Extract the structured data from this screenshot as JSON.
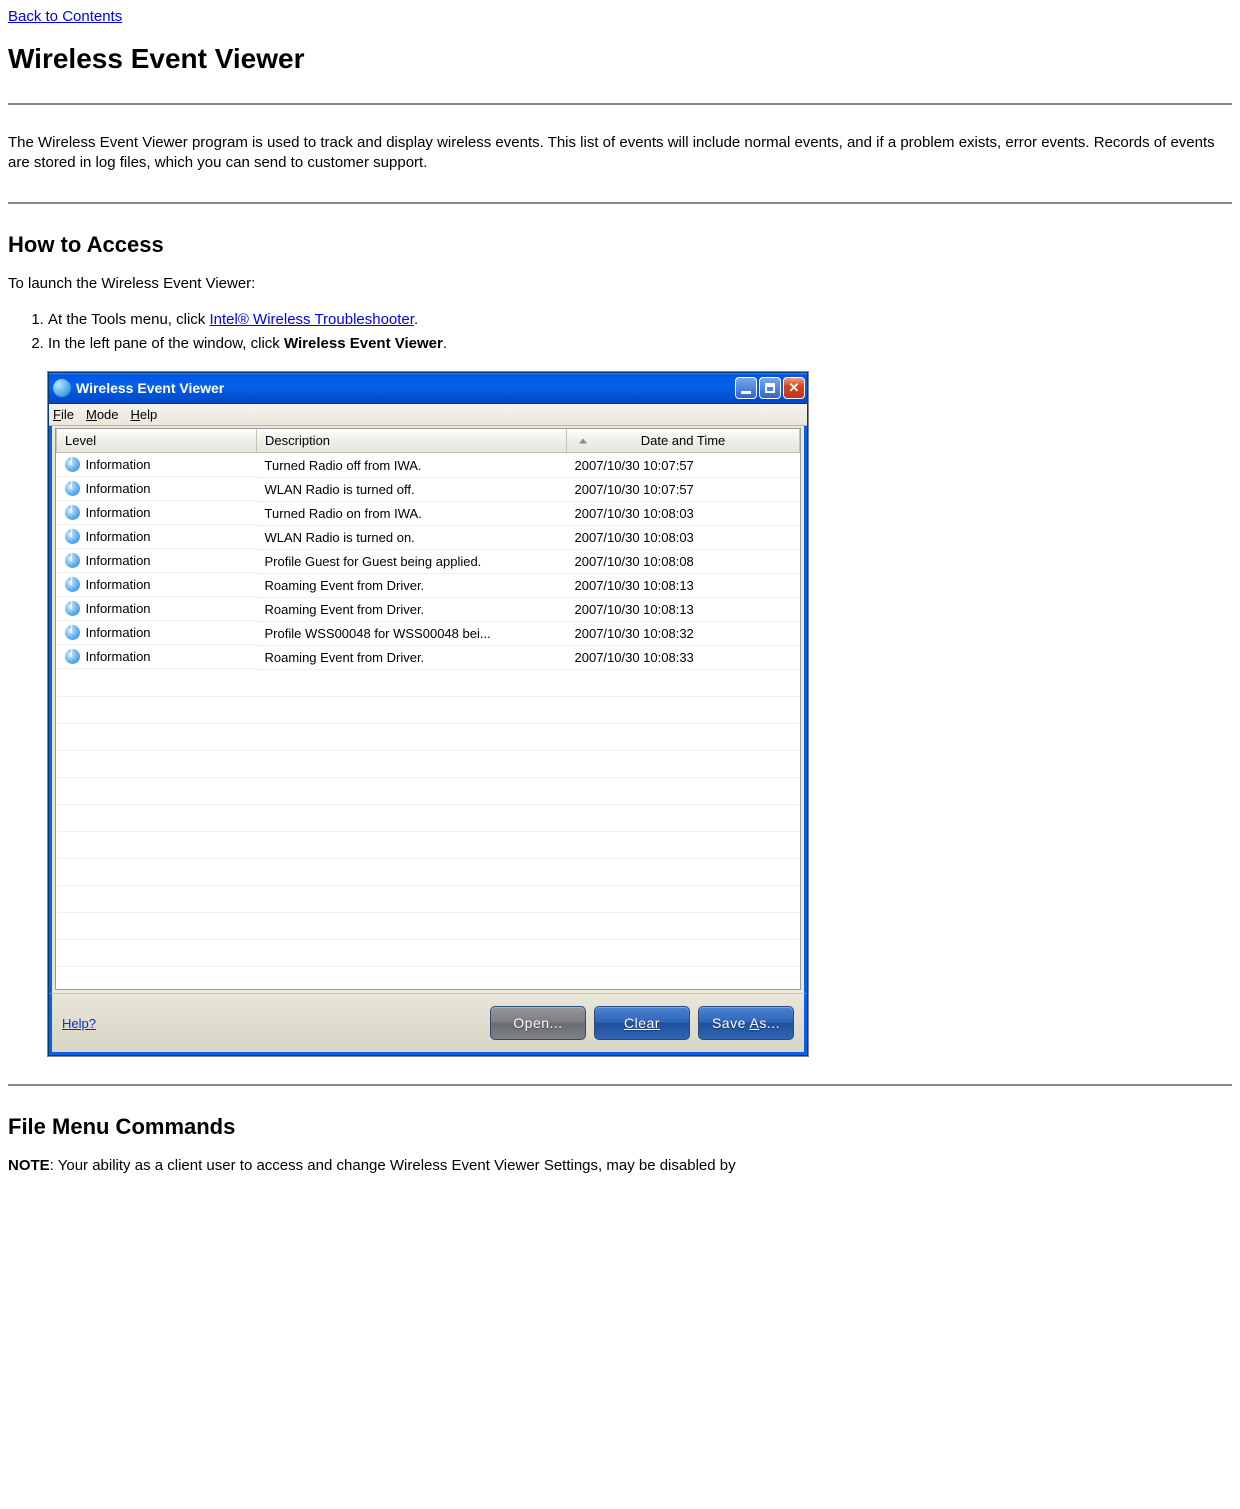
{
  "nav": {
    "back_link": "Back to Contents"
  },
  "page": {
    "title": "Wireless Event Viewer",
    "intro": "The Wireless Event Viewer program is used to track and display wireless events. This list of events will include normal events, and if a problem exists, error events. Records of events are stored in log files, which you can send to customer support.",
    "how_heading": "How to Access",
    "intro_launch": "To launch the Wireless Event Viewer:",
    "step1_prefix": "At the Tools menu, click ",
    "step1_link": "Intel® Wireless Troubleshooter",
    "step1_suffix": ".",
    "step2_prefix": "In the left pane of the window, click ",
    "step2_bold": "Wireless Event Viewer",
    "step2_suffix": ".",
    "file_menu_heading": "File Menu Commands",
    "note_label": "NOTE",
    "note_text": ": Your ability as a client user to access and change Wireless Event Viewer Settings, may be disabled by"
  },
  "window": {
    "title": "Wireless Event Viewer",
    "menus": {
      "file": "File",
      "mode": "Mode",
      "help": "Help"
    },
    "columns": {
      "level": "Level",
      "description": "Description",
      "date": "Date and Time"
    },
    "rows": [
      {
        "level": "Information",
        "desc": "Turned Radio off from IWA.",
        "date": "2007/10/30 10:07:57"
      },
      {
        "level": "Information",
        "desc": "WLAN Radio is turned off.",
        "date": "2007/10/30 10:07:57"
      },
      {
        "level": "Information",
        "desc": "Turned Radio on from IWA.",
        "date": "2007/10/30 10:08:03"
      },
      {
        "level": "Information",
        "desc": "WLAN Radio is turned on.",
        "date": "2007/10/30 10:08:03"
      },
      {
        "level": "Information",
        "desc": "Profile Guest for Guest being applied.",
        "date": "2007/10/30 10:08:08"
      },
      {
        "level": "Information",
        "desc": "Roaming Event from Driver.",
        "date": "2007/10/30 10:08:13"
      },
      {
        "level": "Information",
        "desc": "Roaming Event from Driver.",
        "date": "2007/10/30 10:08:13"
      },
      {
        "level": "Information",
        "desc": "Profile WSS00048 for WSS00048 bei...",
        "date": "2007/10/30 10:08:32"
      },
      {
        "level": "Information",
        "desc": "Roaming Event from Driver.",
        "date": "2007/10/30 10:08:33"
      }
    ],
    "footer": {
      "help": "Help?",
      "open": "Open...",
      "clear": "Clear",
      "saveas_prefix": "Save ",
      "saveas_underline": "A",
      "saveas_suffix": "s..."
    }
  }
}
